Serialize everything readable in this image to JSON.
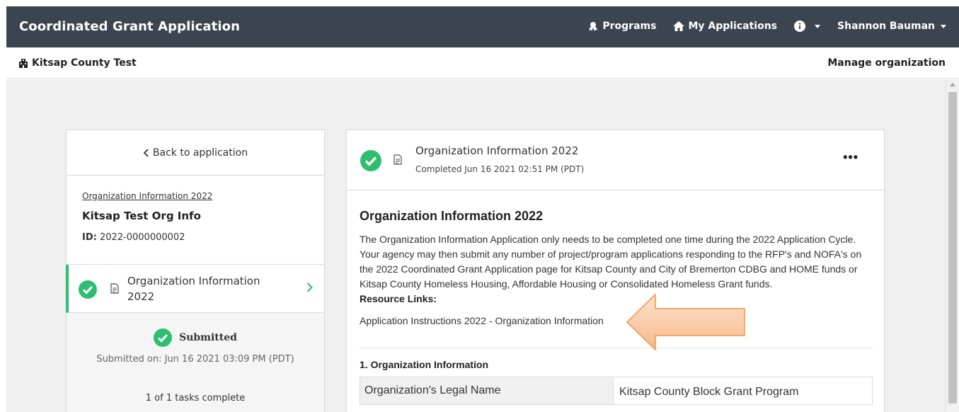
{
  "header": {
    "app_title": "Coordinated Grant Application",
    "nav": {
      "programs": "Programs",
      "my_applications": "My Applications",
      "user": "Shannon Bauman"
    }
  },
  "subheader": {
    "org": "Kitsap County Test",
    "manage": "Manage organization"
  },
  "sidebar": {
    "back": "Back to application",
    "form_link": "Organization Information 2022",
    "app_name": "Kitsap Test Org Info",
    "id_label": "ID:",
    "id_value": "2022-0000000002",
    "task_label": "Organization Information 2022",
    "status": "Submitted",
    "submitted_on": "Submitted on: Jun 16 2021 03:09 PM (PDT)",
    "tasks_complete": "1 of 1 tasks complete"
  },
  "main": {
    "title": "Organization Information 2022",
    "completed": "Completed Jun 16 2021 02:51 PM (PDT)",
    "more": "•••",
    "heading": "Organization Information 2022",
    "description": "The Organization Information Application only needs to be completed one time during the 2022 Application Cycle. Your agency may then submit any number of project/program applications responding to the RFP's and NOFA's on the 2022 Coordinated Grant Application page for Kitsap County and City of Bremerton CDBG and HOME funds or Kitsap County Homeless Housing, Affordable Housing or Consolidated Homeless Grant funds.",
    "resource_title": "Resource Links:",
    "resource_link": "Application Instructions 2022 - Organization Information",
    "section_title": "1. Organization Information",
    "field_label": "Organization's Legal Name",
    "field_value": "Kitsap County Block Grant Program"
  },
  "colors": {
    "topbar": "#3b4550",
    "success": "#2dbf6f",
    "arrow_fill": "#f9c9a3",
    "arrow_stroke": "#f0a86b"
  }
}
